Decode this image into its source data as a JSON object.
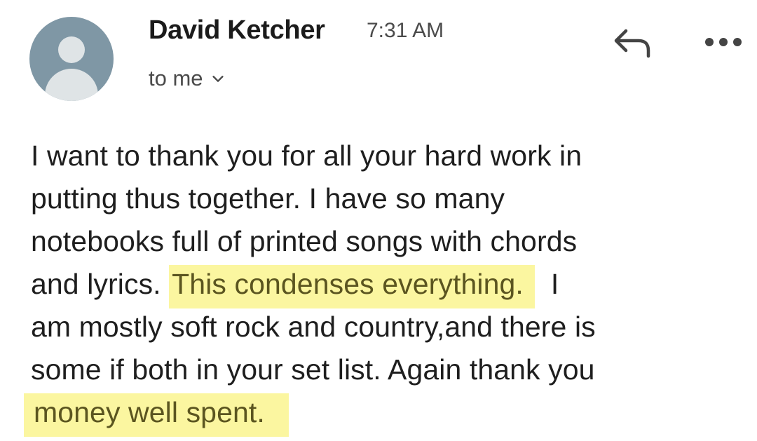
{
  "email": {
    "sender_name": "David Ketcher",
    "time": "7:31 AM",
    "recipient": "to me",
    "body": {
      "line1": "I want to thank you for all your hard work in",
      "line2": "putting thus together. I have so many",
      "line3": "notebooks full of printed songs with chords",
      "line4_pre": "and lyrics. ",
      "line4_highlight": "This condenses everything.",
      "line4_post": "  I",
      "line5": "am mostly soft rock and country,and there is",
      "line6": "some if both in your set list. Again thank you",
      "line7_highlight": "money well spent."
    }
  },
  "icons": {
    "avatar": "default-avatar-icon",
    "recipient_toggle": "chevron-down-icon",
    "reply": "reply-icon",
    "more": "more-horizontal-icon"
  },
  "colors": {
    "avatar_bg": "#7f97a5",
    "highlight_bg": "#fbf6a0",
    "highlight_text": "#5b5520"
  }
}
